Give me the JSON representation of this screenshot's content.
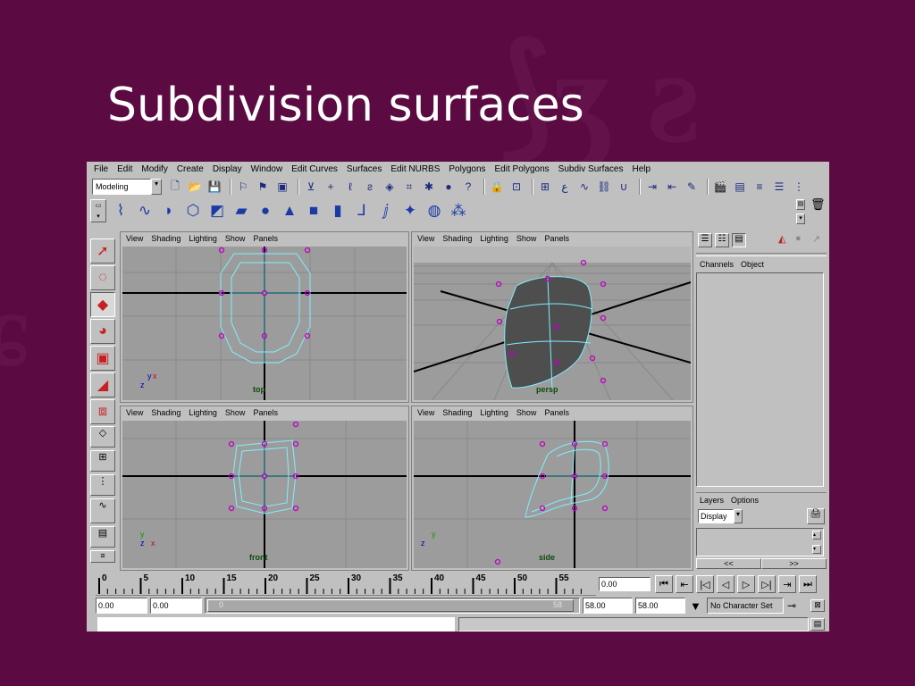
{
  "slide": {
    "title": "Subdivision surfaces"
  },
  "menu": [
    "File",
    "Edit",
    "Modify",
    "Create",
    "Display",
    "Window",
    "Edit Curves",
    "Surfaces",
    "Edit NURBS",
    "Polygons",
    "Edit Polygons",
    "Subdiv Surfaces",
    "Help"
  ],
  "mode_select": "Modeling",
  "viewport_menu": [
    "View",
    "Shading",
    "Lighting",
    "Show",
    "Panels"
  ],
  "viewports": {
    "top": "top",
    "persp": "persp",
    "front": "front",
    "side": "side"
  },
  "axes": {
    "x": "x",
    "y": "y",
    "z": "z"
  },
  "channel_box": {
    "tabs": [
      "Channels",
      "Object"
    ]
  },
  "layers": {
    "tabs": [
      "Layers",
      "Options"
    ],
    "display": "Display"
  },
  "scroll_arrows": {
    "left": "<<",
    "right": ">>"
  },
  "timeline": {
    "ticks": [
      "0",
      "5",
      "10",
      "15",
      "20",
      "25",
      "30",
      "35",
      "40",
      "45",
      "50",
      "55"
    ],
    "current_time": "0.00"
  },
  "range": {
    "start": "0.00",
    "anim_start": "0.00",
    "slider_left": "0",
    "slider_right": "58",
    "anim_end": "58.00",
    "end": "58.00"
  },
  "character_set": "No Character Set",
  "colors": {
    "background": "#5c0a42",
    "ui_gray": "#c0c0c0",
    "viewport": "#9c9c9c",
    "wire": "#7ff0ff",
    "cv": "#c000c0"
  },
  "icons": [
    "select-arrow-icon",
    "lasso-icon",
    "move-icon",
    "rotate-icon",
    "scale-icon",
    "manipulator-icon",
    "camera-icon",
    "sphere-icon",
    "cone-icon",
    "cube-icon",
    "cylinder-icon",
    "curve-tool-icon",
    "key-icon",
    "trash-icon"
  ]
}
